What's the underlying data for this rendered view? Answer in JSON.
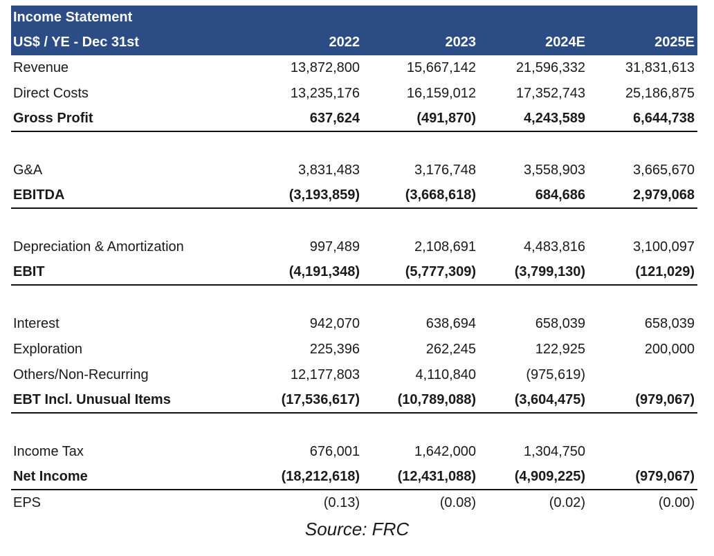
{
  "table": {
    "title": "Income Statement",
    "unit_label": "US$ / YE - Dec 31st",
    "years": [
      "2022",
      "2023",
      "2024E",
      "2025E"
    ],
    "groups": [
      [
        {
          "label": "Revenue",
          "values": [
            "13,872,800",
            "15,667,142",
            "21,596,332",
            "31,831,613"
          ],
          "bold": false
        },
        {
          "label": "Direct Costs",
          "values": [
            "13,235,176",
            "16,159,012",
            "17,352,743",
            "25,186,875"
          ],
          "bold": false
        },
        {
          "label": "Gross Profit",
          "values": [
            "637,624",
            "(491,870)",
            "4,243,589",
            "6,644,738"
          ],
          "bold": true
        }
      ],
      [
        {
          "label": "G&A",
          "values": [
            "3,831,483",
            "3,176,748",
            "3,558,903",
            "3,665,670"
          ],
          "bold": false
        },
        {
          "label": "EBITDA",
          "values": [
            "(3,193,859)",
            "(3,668,618)",
            "684,686",
            "2,979,068"
          ],
          "bold": true
        }
      ],
      [
        {
          "label": "Depreciation & Amortization",
          "values": [
            "997,489",
            "2,108,691",
            "4,483,816",
            "3,100,097"
          ],
          "bold": false
        },
        {
          "label": "EBIT",
          "values": [
            "(4,191,348)",
            "(5,777,309)",
            "(3,799,130)",
            "(121,029)"
          ],
          "bold": true
        }
      ],
      [
        {
          "label": "Interest",
          "values": [
            "942,070",
            "638,694",
            "658,039",
            "658,039"
          ],
          "bold": false
        },
        {
          "label": "Exploration",
          "values": [
            "225,396",
            "262,245",
            "122,925",
            "200,000"
          ],
          "bold": false
        },
        {
          "label": "Others/Non-Recurring",
          "values": [
            "12,177,803",
            "4,110,840",
            "(975,619)",
            ""
          ],
          "bold": false
        },
        {
          "label": "EBT Incl. Unusual Items",
          "values": [
            "(17,536,617)",
            "(10,789,088)",
            "(3,604,475)",
            "(979,067)"
          ],
          "bold": true
        }
      ],
      [
        {
          "label": "Income Tax",
          "values": [
            "676,001",
            "1,642,000",
            "1,304,750",
            ""
          ],
          "bold": false
        },
        {
          "label": "Net Income",
          "values": [
            "(18,212,618)",
            "(12,431,088)",
            "(4,909,225)",
            "(979,067)"
          ],
          "bold": true
        },
        {
          "label": "EPS",
          "values": [
            "(0.13)",
            "(0.08)",
            "(0.02)",
            "(0.00)"
          ],
          "bold": false
        }
      ]
    ]
  },
  "source": "Source: FRC",
  "colors": {
    "header_bg": "#2b4c84",
    "header_text": "#ffffff"
  }
}
